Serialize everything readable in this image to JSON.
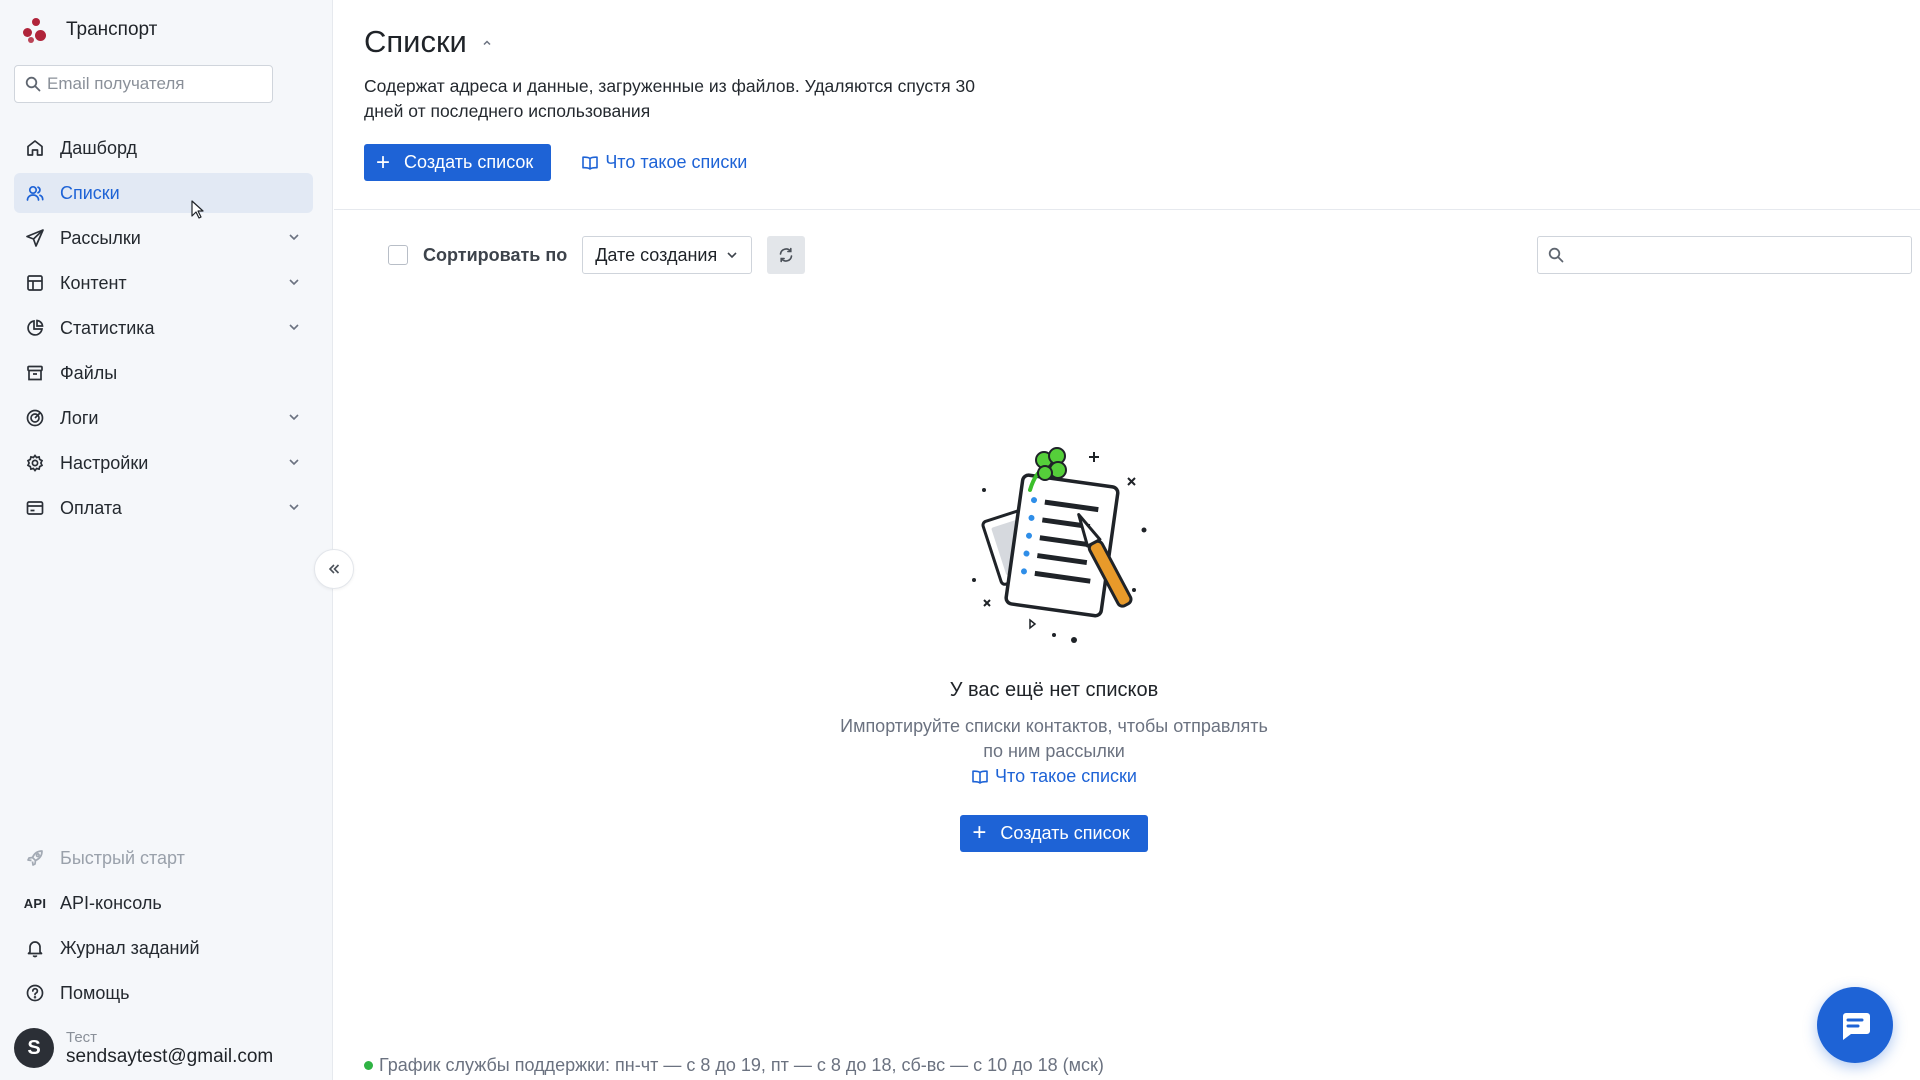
{
  "sidebar": {
    "brand": "Транспорт",
    "search_placeholder": "Email получателя",
    "items": [
      {
        "label": "Дашборд",
        "icon": "home-icon"
      },
      {
        "label": "Списки",
        "icon": "users-icon",
        "active": true
      },
      {
        "label": "Рассылки",
        "icon": "send-icon",
        "expandable": true
      },
      {
        "label": "Контент",
        "icon": "layout-icon",
        "expandable": true
      },
      {
        "label": "Статистика",
        "icon": "pie-chart-icon",
        "expandable": true
      },
      {
        "label": "Файлы",
        "icon": "archive-icon"
      },
      {
        "label": "Логи",
        "icon": "target-icon",
        "expandable": true
      },
      {
        "label": "Настройки",
        "icon": "gear-icon",
        "expandable": true
      },
      {
        "label": "Оплата",
        "icon": "credit-card-icon",
        "expandable": true
      }
    ],
    "bottom_items": [
      {
        "label": "Быстрый старт",
        "icon": "rocket-icon"
      },
      {
        "label": "API-консоль",
        "icon": "api-icon",
        "icon_text": "API"
      },
      {
        "label": "Журнал заданий",
        "icon": "bell-icon"
      },
      {
        "label": "Помощь",
        "icon": "help-icon"
      }
    ],
    "user": {
      "avatar_letter": "S",
      "name": "Тест",
      "email": "sendsaytest@gmail.com"
    }
  },
  "main": {
    "title": "Списки",
    "description": "Содержат адреса и данные, загруженные из файлов. Удаляются спустя 30 дней от последнего использования",
    "create_button": "Создать список",
    "help_link": "Что такое списки",
    "sort_label": "Сортировать по",
    "sort_value": "Дате создания",
    "search_placeholder": "",
    "empty": {
      "title": "У вас ещё нет списков",
      "text_line1": "Импортируйте списки контактов, чтобы отправлять",
      "text_line2": "по ним рассылки",
      "link": "Что такое списки",
      "button": "Создать список"
    },
    "footer": "График службы поддержки: пн-чт — с 8 до 19, пт — с 8 до 18, сб-вс — с 10 до 18 (мск)"
  },
  "colors": {
    "accent": "#1e63d6",
    "brand": "#b0243a",
    "status_online": "#2fb344"
  }
}
